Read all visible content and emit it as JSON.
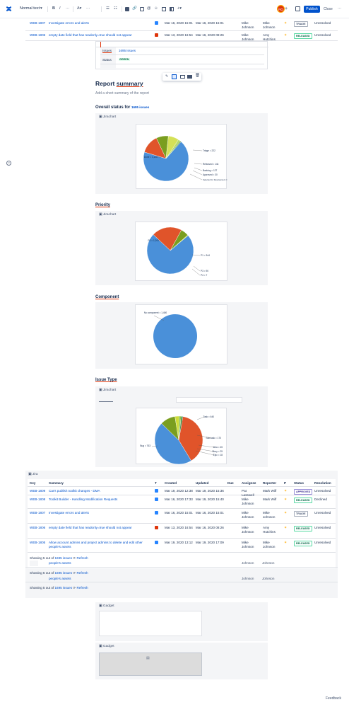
{
  "toolbar": {
    "text_style": "Normal text",
    "publish": "Publish",
    "close": "Close",
    "avatar_initials": "RO"
  },
  "top_rows": [
    {
      "key": "WEB-1807",
      "summary": "Investigate errors and alerts",
      "created": "Mar 16, 2020 15:01",
      "updated": "Mar 16, 2020 15:01",
      "assignee": "Mike Johnson",
      "reporter": "Mike Johnson",
      "status": "TRIAGE",
      "resolution": "Unresolved"
    },
    {
      "key": "WEB-1806",
      "summary": "empty date field that has readonly=true should not appear",
      "created": "Mar 13, 2020 16:54",
      "updated": "Mar 16, 2020 08:26",
      "assignee": "Mike Johnson",
      "reporter": "Amy Hutchins",
      "status": "RELEASED",
      "resolution": "Unresolved"
    }
  ],
  "detail_card": {
    "issues_label": "Issues",
    "issues_value": "1695 issues",
    "status_label": "Status",
    "status_value": "GREEN"
  },
  "report": {
    "title_prefix": "Report ",
    "title_underlined": "summary",
    "placeholder": "Add a short summary of the report",
    "overall_prefix": "Overall status for ",
    "overall_link": "1695 issues"
  },
  "sections": {
    "priority": "Priority",
    "component": "Component",
    "issue_type": "Issue Type"
  },
  "jirachart_label": "Jirachart",
  "jira_label": "Jira",
  "gadget_label": "Gadget",
  "chart_data": [
    {
      "type": "pie",
      "title": "",
      "slices": [
        {
          "label": "Done",
          "value": 1128
        },
        {
          "label": "Triage",
          "value": 222
        },
        {
          "label": "Released",
          "value": 144
        },
        {
          "label": "Backlog",
          "value": 127
        },
        {
          "label": "Approved",
          "value": 30
        },
        {
          "label": "Selected for Development",
          "value": 9
        }
      ],
      "colors": [
        "#4a90d9",
        "#e0542a",
        "#7a9e1f",
        "#d4e157",
        "#b4d86b",
        "#2e7d32"
      ]
    },
    {
      "type": "pie",
      "title": "",
      "slices": [
        {
          "label": "P2",
          "value": 1200
        },
        {
          "label": "P1",
          "value": 344
        },
        {
          "label": "P3",
          "value": 90
        },
        {
          "label": "P4",
          "value": 7
        }
      ],
      "colors": [
        "#4a90d9",
        "#e0542a",
        "#7a9e1f",
        "#cddc39"
      ]
    },
    {
      "type": "pie",
      "title": "",
      "slices": [
        {
          "label": "No component",
          "value": 1400
        }
      ],
      "colors": [
        "#4a90d9"
      ]
    },
    {
      "type": "pie",
      "title": "",
      "slices": [
        {
          "label": "Task",
          "value": 640
        },
        {
          "label": "Bug",
          "value": 763
        },
        {
          "label": "Sub-task",
          "value": 170
        },
        {
          "label": "Idea",
          "value": 45
        },
        {
          "label": "Story",
          "value": 25
        },
        {
          "label": "Epic",
          "value": 18
        }
      ],
      "colors": [
        "#e0542a",
        "#4a90d9",
        "#7a9e1f",
        "#cddc39",
        "#8bc34a",
        "#2e7d32"
      ]
    }
  ],
  "pie_labels": {
    "c1": [
      "Done = 1,128",
      "Triage = 222",
      "Released = 144",
      "Backlog = 127",
      "Approved = 30",
      "Selected for Development = 9"
    ],
    "c2": [
      "P2 = 1,200",
      "P1 = 344",
      "P3 = 90",
      "P4 = 7"
    ],
    "c3": [
      "No component = 1,400"
    ],
    "c4": [
      "Task = 640",
      "Bug = 763",
      "Sub-task = 170",
      "Idea = 45",
      "Story = 25",
      "Epic = 18"
    ]
  },
  "table": {
    "headers": [
      "Key",
      "Summary",
      "T",
      "Created",
      "Updated",
      "Due",
      "Assignee",
      "Reporter",
      "P",
      "Status",
      "Resolution"
    ],
    "rows": [
      {
        "key": "WEB-1809",
        "summary": "Can't publish toolkit changes - DMA",
        "created": "Mar 19, 2020 12:38",
        "updated": "Mar 19, 2020 15:36",
        "assignee": "Pat Lasswell",
        "reporter": "Mark Wilf",
        "status": "APPROVED",
        "resolution": "Unresolved"
      },
      {
        "key": "WEB-1808",
        "summary": "Toolkit Builder - Handling Modification Requests",
        "created": "Mar 16, 2020 17:33",
        "updated": "Mar 19, 2020 15:40",
        "assignee": "Mike Johnson",
        "reporter": "Mark Wilf",
        "status": "RELEASED",
        "resolution": "Declined"
      },
      {
        "key": "WEB-1807",
        "summary": "Investigate errors and alerts",
        "created": "Mar 16, 2020 15:01",
        "updated": "Mar 16, 2020 15:01",
        "assignee": "Mike Johnson",
        "reporter": "Mike Johnson",
        "status": "TRIAGE",
        "resolution": "Unresolved"
      },
      {
        "key": "WEB-1806",
        "summary": "empty date field that has readonly=true should not appear",
        "created": "Mar 13, 2020 16:54",
        "updated": "Mar 16, 2020 08:26",
        "assignee": "Mike Johnson",
        "reporter": "Amy Hutchins",
        "status": "RELEASED",
        "resolution": "Unresolved"
      },
      {
        "key": "WEB-1805",
        "summary": "Allow account admins and project admins to delete and edit other people's assets",
        "created": "Mar 19, 2020 13:12",
        "updated": "Mar 19, 2020 17:09",
        "assignee": "Mike Johnson",
        "reporter": "Mike Johnson",
        "status": "RELEASED",
        "resolution": "Unresolved"
      }
    ]
  },
  "showing": {
    "prefix": "Showing 5 out of ",
    "link": "1695 issues",
    "refresh": "Refresh"
  },
  "ghost": {
    "text": "people's assets",
    "name": "Johnson"
  },
  "feedback": "Feedback"
}
